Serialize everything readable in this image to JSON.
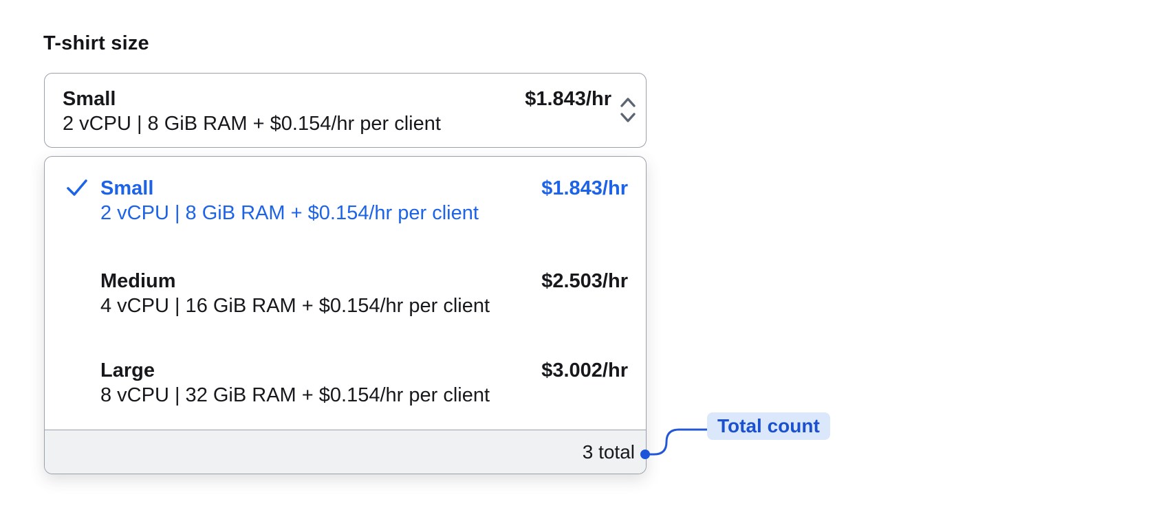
{
  "field": {
    "label": "T-shirt size",
    "select": {
      "selected_name": "Small",
      "selected_specs": "2 vCPU | 8 GiB RAM + $0.154/hr per client",
      "selected_price": "$1.843/hr"
    },
    "dropdown": {
      "options": [
        {
          "name": "Small",
          "specs": "2 vCPU | 8 GiB RAM + $0.154/hr per client",
          "price": "$1.843/hr",
          "selected": true
        },
        {
          "name": "Medium",
          "specs": "4 vCPU | 16 GiB RAM + $0.154/hr per client",
          "price": "$2.503/hr",
          "selected": false
        },
        {
          "name": "Large",
          "specs": "8 vCPU | 32 GiB RAM + $0.154/hr per client",
          "price": "$3.002/hr",
          "selected": false
        }
      ],
      "footer": {
        "total": "3 total"
      }
    }
  },
  "annotation": {
    "label": "Total count"
  },
  "icons": {
    "trigger": "chevron-up-down-icon",
    "selected_option": "check-icon"
  },
  "colors": {
    "accent_blue": "#1d63e8",
    "annotation_blue": "#1b50cf",
    "annotation_pill_bg": "#dbe8fc",
    "border_gray": "#99a0a9",
    "footer_bg": "#eff1f3",
    "text": "#16181b",
    "chevron_gray": "#5c6571"
  }
}
